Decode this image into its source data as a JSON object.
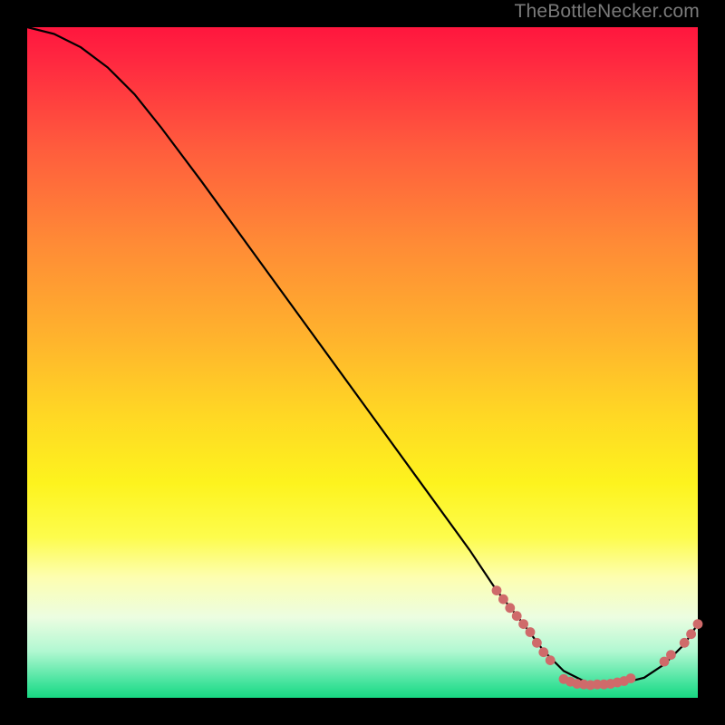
{
  "attribution": "TheBottleNecker.com",
  "chart_data": {
    "type": "line",
    "title": "",
    "xlabel": "",
    "ylabel": "",
    "xlim": [
      0,
      100
    ],
    "ylim": [
      0,
      100
    ],
    "series": [
      {
        "name": "curve",
        "x": [
          0,
          4,
          8,
          12,
          16,
          20,
          26,
          34,
          42,
          50,
          58,
          66,
          70,
          74,
          77,
          80,
          84,
          88,
          92,
          95,
          98,
          100
        ],
        "y": [
          100,
          99,
          97,
          94,
          90,
          85,
          77,
          66,
          55,
          44,
          33,
          22,
          16,
          11,
          7,
          4,
          2,
          2,
          3,
          5,
          8,
          11
        ]
      }
    ],
    "markers": [
      {
        "name": "cluster-left",
        "points": [
          [
            70,
            16
          ],
          [
            71,
            14.7
          ],
          [
            72,
            13.4
          ],
          [
            73,
            12.2
          ],
          [
            74,
            11
          ],
          [
            75,
            9.8
          ],
          [
            76,
            8.2
          ],
          [
            77,
            6.8
          ],
          [
            78,
            5.6
          ]
        ]
      },
      {
        "name": "cluster-floor",
        "points": [
          [
            80,
            2.8
          ],
          [
            81,
            2.4
          ],
          [
            82,
            2.1
          ],
          [
            83,
            2.0
          ],
          [
            84,
            1.9
          ],
          [
            85,
            2.0
          ],
          [
            86,
            2.0
          ],
          [
            87,
            2.1
          ],
          [
            88,
            2.3
          ],
          [
            89,
            2.5
          ],
          [
            90,
            2.9
          ]
        ]
      },
      {
        "name": "cluster-right",
        "points": [
          [
            95,
            5.4
          ],
          [
            96,
            6.4
          ],
          [
            98,
            8.2
          ],
          [
            99,
            9.5
          ],
          [
            100,
            11
          ]
        ]
      }
    ],
    "colors": {
      "marker": "#cf6a6a",
      "curve": "#000000"
    }
  }
}
